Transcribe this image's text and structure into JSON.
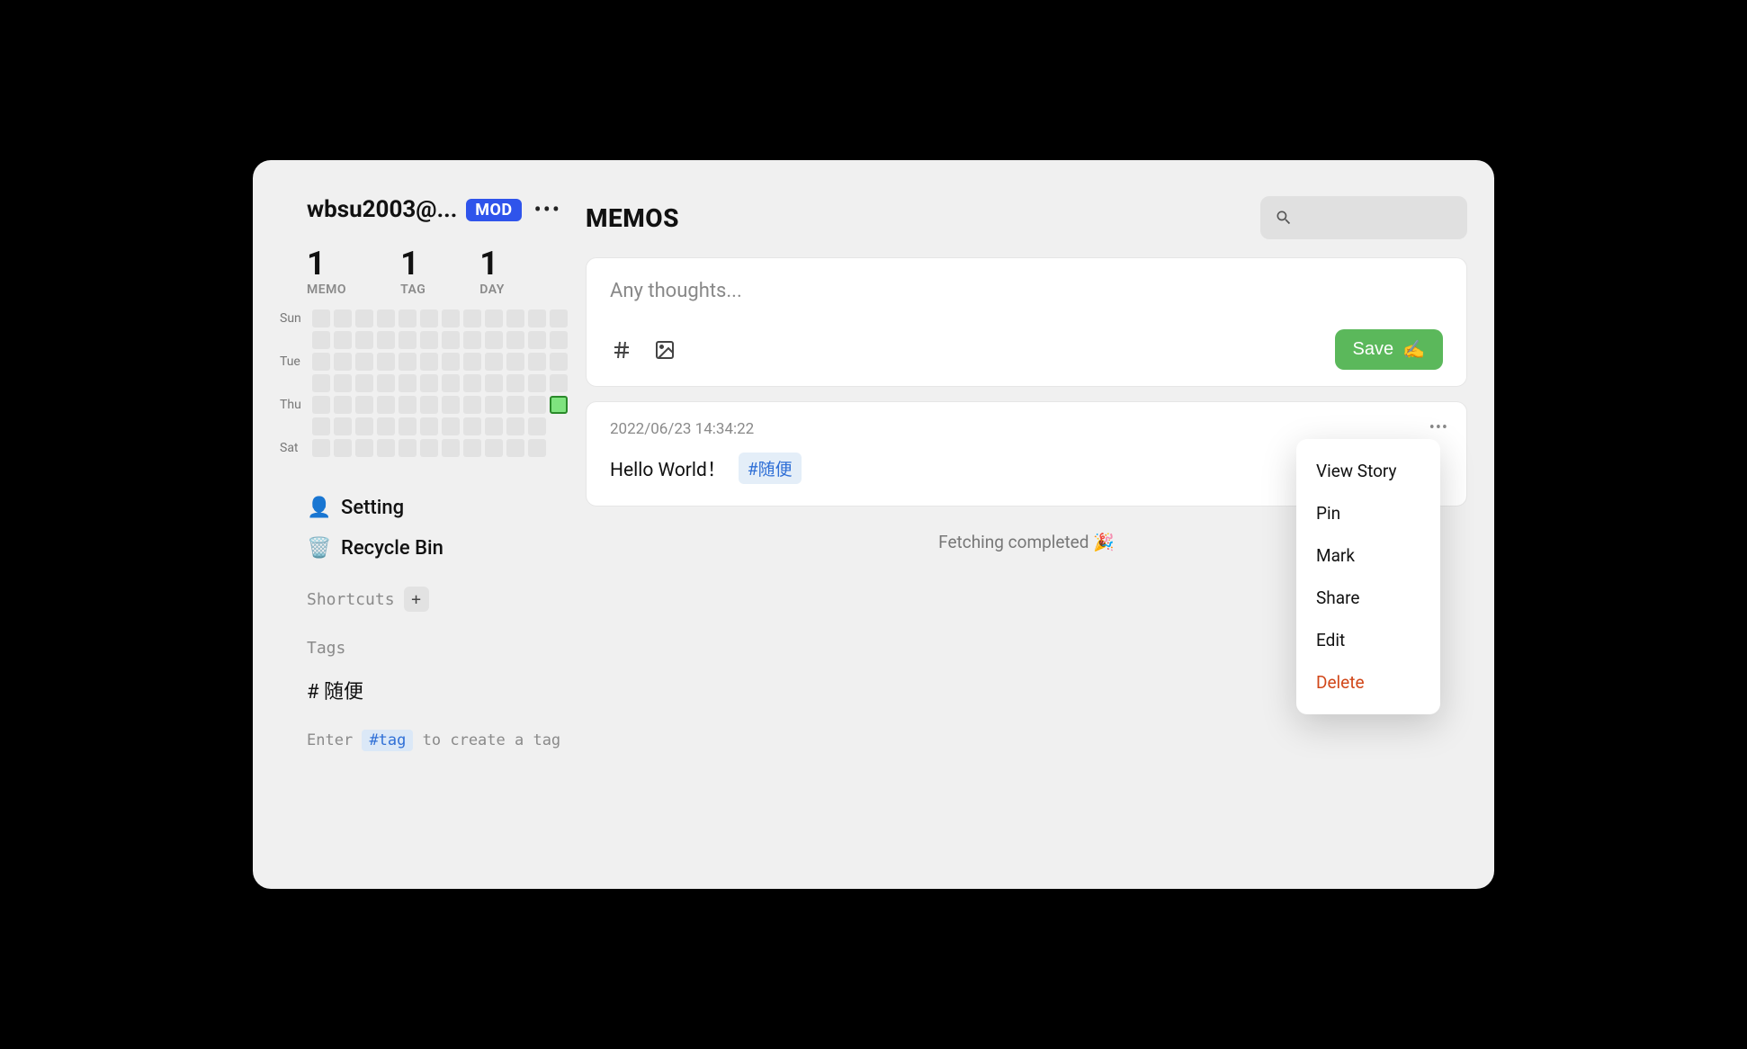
{
  "sidebar": {
    "username": "wbsu2003@...",
    "badge": "MOD",
    "stats": [
      {
        "value": "1",
        "label": "MEMO"
      },
      {
        "value": "1",
        "label": "TAG"
      },
      {
        "value": "1",
        "label": "DAY"
      }
    ],
    "dayLabels": [
      "Sun",
      "",
      "Tue",
      "",
      "Thu",
      "",
      "Sat"
    ],
    "nav": {
      "setting": "Setting",
      "recycle": "Recycle Bin"
    },
    "shortcuts_title": "Shortcuts",
    "tags_title": "Tags",
    "tags": [
      "# 随便"
    ],
    "tag_hint_before": "Enter",
    "tag_hint_chip": "#tag",
    "tag_hint_after": "to create a tag"
  },
  "main": {
    "title": "MEMOS",
    "editor": {
      "placeholder": "Any thoughts...",
      "save_label": "Save",
      "save_emoji": "✍️"
    },
    "memo": {
      "timestamp": "2022/06/23 14:34:22",
      "text": "Hello World！",
      "tag": "#随便"
    },
    "status": "Fetching completed 🎉"
  },
  "context_menu": {
    "items": [
      "View Story",
      "Pin",
      "Mark",
      "Share",
      "Edit"
    ],
    "delete": "Delete"
  }
}
